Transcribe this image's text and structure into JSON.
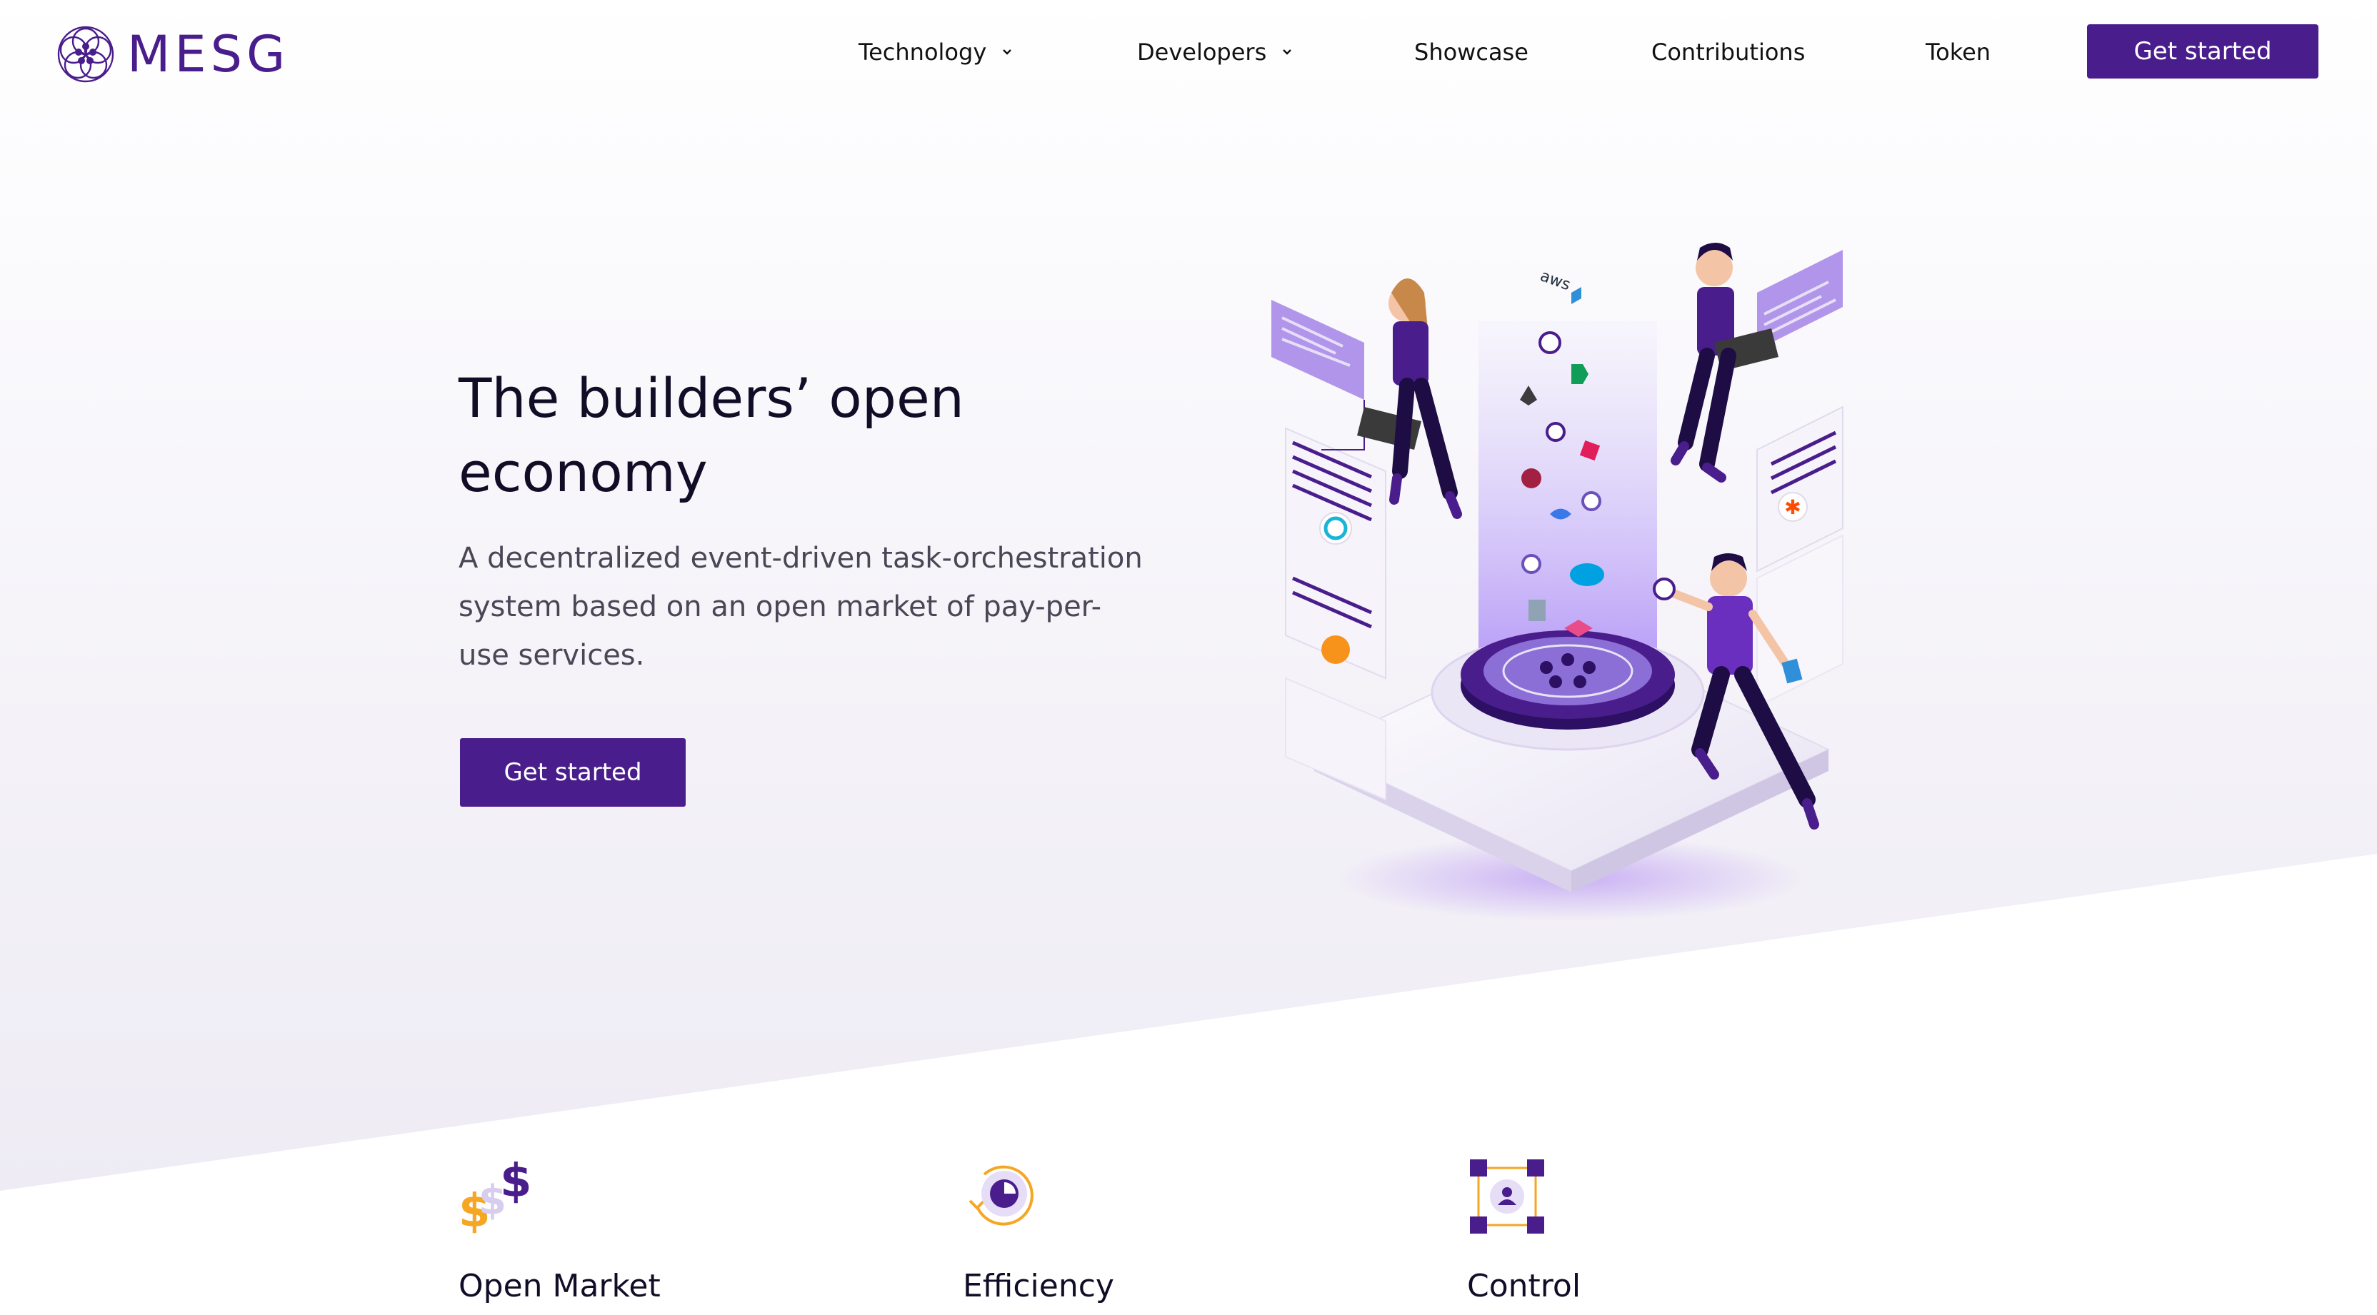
{
  "brand": {
    "name": "MESG",
    "color": "#4a1d8c"
  },
  "nav": {
    "items": [
      {
        "label": "Technology",
        "has_dropdown": true
      },
      {
        "label": "Developers",
        "has_dropdown": true
      },
      {
        "label": "Showcase",
        "has_dropdown": false
      },
      {
        "label": "Contributions",
        "has_dropdown": false
      },
      {
        "label": "Token",
        "has_dropdown": false
      }
    ],
    "cta_label": "Get started"
  },
  "hero": {
    "title": "The builders’ open economy",
    "description": "A decentralized event-driven task-orchestration system based on an open market of pay-per-use services.",
    "cta_label": "Get started",
    "illustration_icon": "isometric-platform-illustration"
  },
  "illustration_labels": {
    "aws": "aws"
  },
  "features": [
    {
      "title": "Open Market",
      "icon": "dollar-signs-icon"
    },
    {
      "title": "Efficiency",
      "icon": "efficiency-cycle-icon"
    },
    {
      "title": "Control",
      "icon": "control-frame-icon"
    }
  ],
  "colors": {
    "primary": "#4a1d8c",
    "accent_orange": "#f5a623",
    "text_dark": "#120d26",
    "text_muted": "#4a4656",
    "background_band": "#f3f1f7"
  }
}
